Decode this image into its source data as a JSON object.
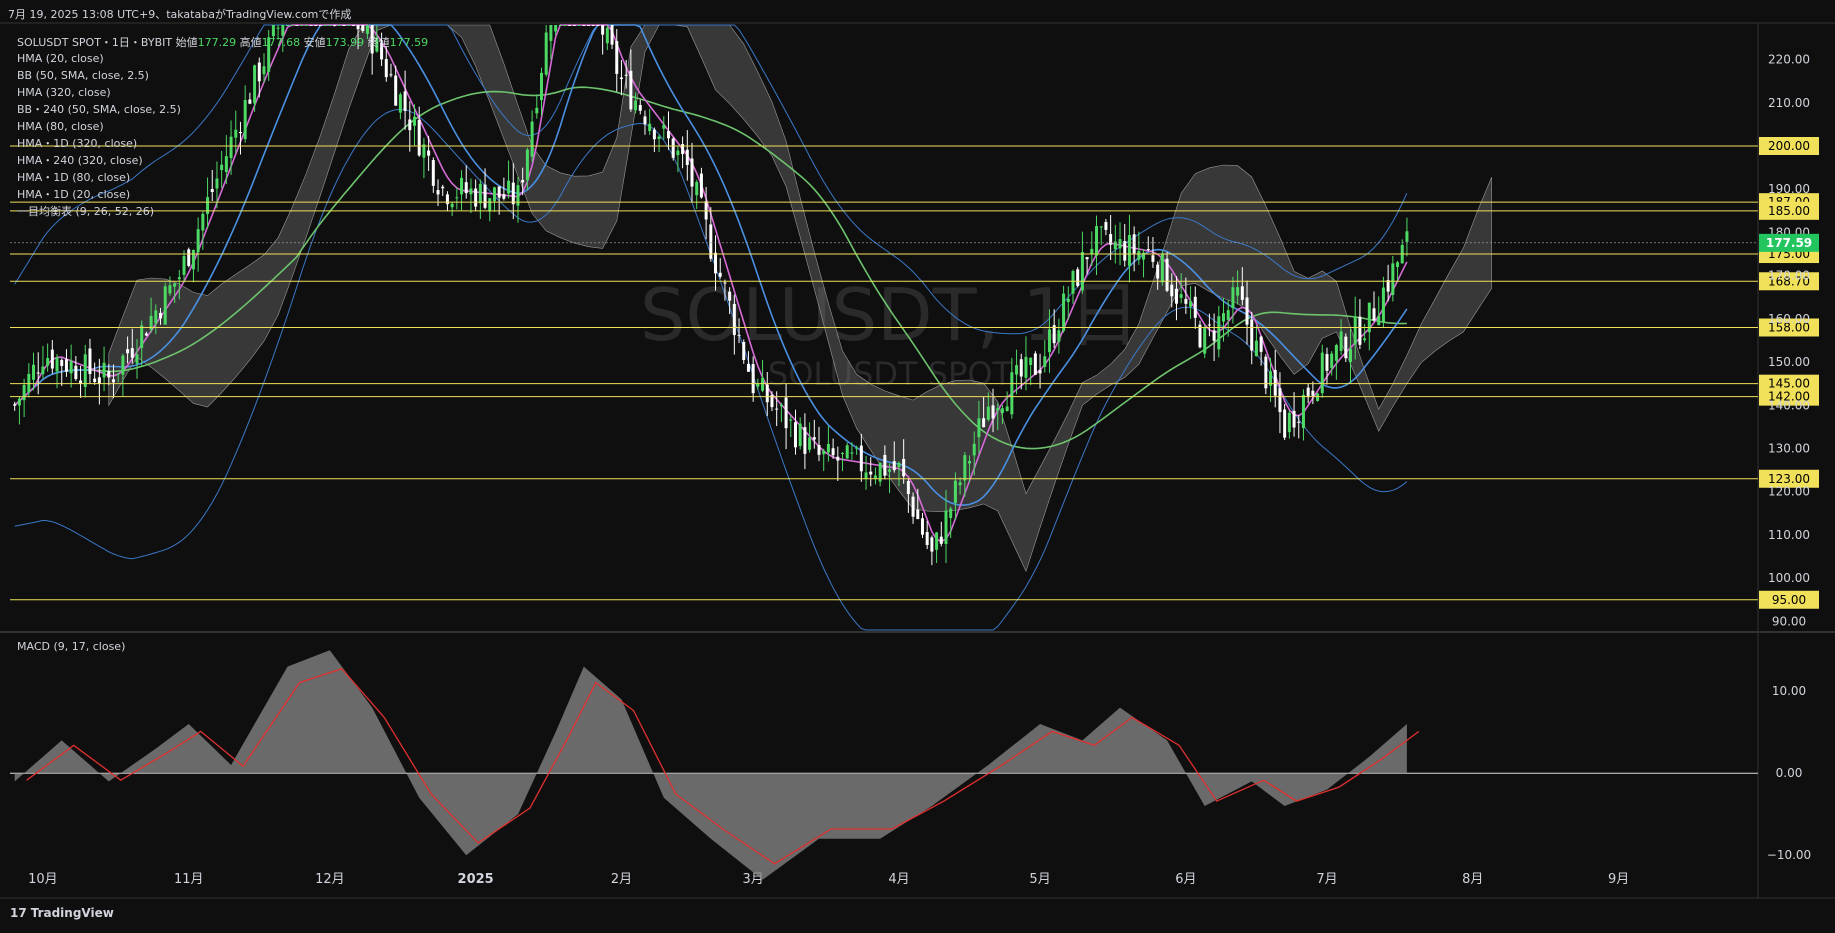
{
  "header": {
    "created": "7月 19, 2025 13:08 UTC+9、takatabaがTradingView.comで作成",
    "symbol": "SOLUSDT SPOT・1日・BYBIT",
    "ohlc_open_label": "始値",
    "ohlc_open": "177.29",
    "ohlc_high_label": "高値",
    "ohlc_high": "177.68",
    "ohlc_low_label": "安値",
    "ohlc_low": "173.99",
    "ohlc_close_label": "終値",
    "ohlc_close": "177.59"
  },
  "indicators": [
    "HMA (20, close)",
    "BB (50, SMA, close, 2.5)",
    "HMA (320, close)",
    "BB・240 (50, SMA, close, 2.5)",
    "HMA (80, close)",
    "HMA・1D (320, close)",
    "HMA・240 (320, close)",
    "HMA・1D (80, close)",
    "HMA・1D (20, close)",
    "一目均衡表 (9, 26, 52, 26)"
  ],
  "watermark": {
    "main": "SOLUSDT, 1日",
    "sub": "SOLUSDT SPOT"
  },
  "macd_label": "MACD (9, 17, close)",
  "brand": "TradingView",
  "colors": {
    "background": "#0f0f0f",
    "up": "#4cd964",
    "down": "#ffffff",
    "level": "#f0e05a",
    "price_tag": "#22c55e",
    "hma20": "#d66ad6",
    "hma80": "#4a90e2",
    "hma320": "#6ec46e",
    "bb": "#3b78c8",
    "cloud": "#6b6b6b",
    "macd_signal": "#e03030",
    "macd_hist": "#8a8a8a"
  },
  "chart_data": [
    {
      "type": "candlestick",
      "title": "SOLUSDT, 1日",
      "x_ticks": [
        "10月",
        "11月",
        "12月",
        "2025",
        "2月",
        "3月",
        "4月",
        "5月",
        "6月",
        "7月",
        "8月",
        "9月"
      ],
      "y_ticks": [
        90,
        100,
        110,
        120,
        130,
        140,
        150,
        160,
        170,
        180,
        190,
        210,
        220
      ],
      "ylim": [
        88,
        228
      ],
      "current_price": 177.59,
      "horizontal_levels": [
        200,
        187,
        185,
        175,
        168.7,
        158,
        145,
        142,
        123,
        95
      ],
      "level_labels": [
        "200.00",
        "187.00",
        "185.00",
        "175.00",
        "168.70",
        "158.00",
        "145.00",
        "142.00",
        "123.00",
        "95.00"
      ],
      "axis_labels": [
        "90.00",
        "100.00",
        "110.00",
        "120.00",
        "130.00",
        "140.00",
        "150.00",
        "160.00",
        "170.00",
        "180.00",
        "190.00",
        "210.00",
        "220.00"
      ],
      "current_label": "177.59",
      "closes_monthly_approx": [
        {
          "month": "2024-09-25",
          "close": 140
        },
        {
          "month": "2024-10-01",
          "close": 152
        },
        {
          "month": "2024-10-15",
          "close": 146
        },
        {
          "month": "2024-10-30",
          "close": 170
        },
        {
          "month": "2024-11-15",
          "close": 215
        },
        {
          "month": "2024-11-25",
          "close": 240
        },
        {
          "month": "2024-12-10",
          "close": 225
        },
        {
          "month": "2024-12-25",
          "close": 190
        },
        {
          "month": "2025-01-10",
          "close": 188
        },
        {
          "month": "2025-01-20",
          "close": 250
        },
        {
          "month": "2025-02-01",
          "close": 215
        },
        {
          "month": "2025-02-15",
          "close": 195
        },
        {
          "month": "2025-03-01",
          "close": 145
        },
        {
          "month": "2025-03-15",
          "close": 128
        },
        {
          "month": "2025-04-01",
          "close": 125
        },
        {
          "month": "2025-04-08",
          "close": 105
        },
        {
          "month": "2025-04-20",
          "close": 140
        },
        {
          "month": "2025-05-01",
          "close": 150
        },
        {
          "month": "2025-05-12",
          "close": 178
        },
        {
          "month": "2025-05-25",
          "close": 175
        },
        {
          "month": "2025-06-05",
          "close": 155
        },
        {
          "month": "2025-06-12",
          "close": 165
        },
        {
          "month": "2025-06-22",
          "close": 135
        },
        {
          "month": "2025-07-01",
          "close": 150
        },
        {
          "month": "2025-07-10",
          "close": 160
        },
        {
          "month": "2025-07-18",
          "close": 177.59
        }
      ]
    },
    {
      "type": "area",
      "title": "MACD (9, 17, close)",
      "y_ticks": [
        "10.00",
        "0.00",
        "−10.00"
      ],
      "ylim": [
        -14,
        16
      ],
      "macd_points": [
        {
          "d": "2024-09-25",
          "v": -1
        },
        {
          "d": "2024-10-05",
          "v": 4
        },
        {
          "d": "2024-10-15",
          "v": -1
        },
        {
          "d": "2024-10-25",
          "v": 3
        },
        {
          "d": "2024-11-01",
          "v": 6
        },
        {
          "d": "2024-11-10",
          "v": 1
        },
        {
          "d": "2024-11-22",
          "v": 13
        },
        {
          "d": "2024-12-01",
          "v": 15
        },
        {
          "d": "2024-12-10",
          "v": 8
        },
        {
          "d": "2024-12-20",
          "v": -3
        },
        {
          "d": "2024-12-30",
          "v": -10
        },
        {
          "d": "2025-01-10",
          "v": -5
        },
        {
          "d": "2025-01-18",
          "v": 5
        },
        {
          "d": "2025-01-24",
          "v": 13
        },
        {
          "d": "2025-02-01",
          "v": 9
        },
        {
          "d": "2025-02-10",
          "v": -3
        },
        {
          "d": "2025-02-20",
          "v": -8
        },
        {
          "d": "2025-03-03",
          "v": -13
        },
        {
          "d": "2025-03-15",
          "v": -8
        },
        {
          "d": "2025-03-28",
          "v": -8
        },
        {
          "d": "2025-04-08",
          "v": -4
        },
        {
          "d": "2025-04-20",
          "v": 1
        },
        {
          "d": "2025-05-01",
          "v": 6
        },
        {
          "d": "2025-05-10",
          "v": 4
        },
        {
          "d": "2025-05-18",
          "v": 8
        },
        {
          "d": "2025-05-28",
          "v": 4
        },
        {
          "d": "2025-06-05",
          "v": -4
        },
        {
          "d": "2025-06-15",
          "v": -1
        },
        {
          "d": "2025-06-22",
          "v": -4
        },
        {
          "d": "2025-07-01",
          "v": -2
        },
        {
          "d": "2025-07-10",
          "v": 2
        },
        {
          "d": "2025-07-18",
          "v": 6
        }
      ]
    }
  ]
}
